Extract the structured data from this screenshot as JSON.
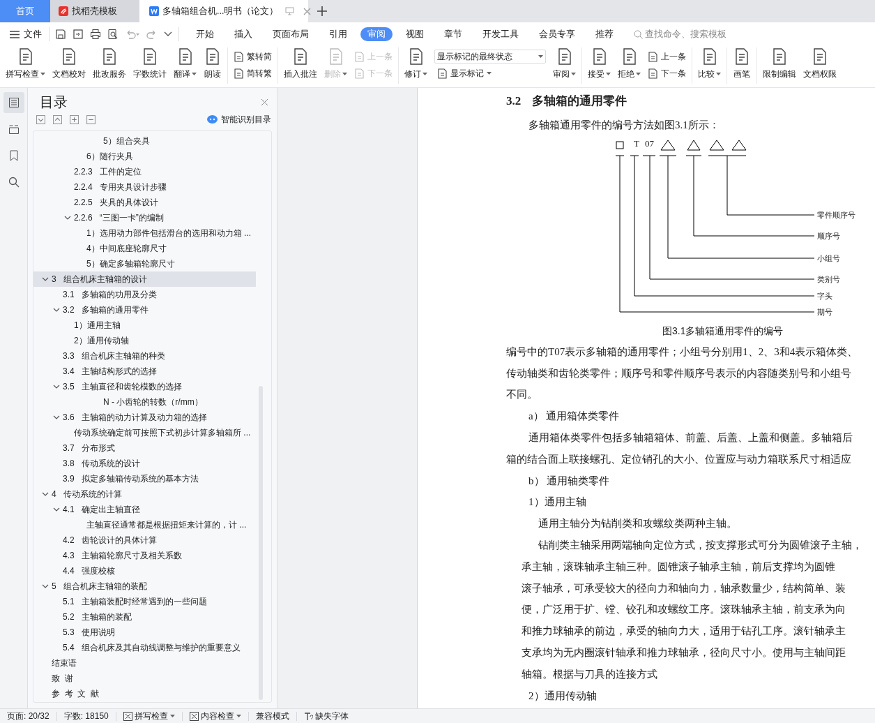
{
  "tabs": [
    {
      "kind": "home",
      "label": "首页",
      "selected": false
    },
    {
      "kind": "web",
      "label": "找稻壳模板",
      "selected": false
    },
    {
      "kind": "doc",
      "label": "多轴箱组合机...明书（论文）",
      "selected": true
    }
  ],
  "menu": {
    "file": "文件",
    "tabs": [
      {
        "label": "开始",
        "selected": false
      },
      {
        "label": "插入",
        "selected": false
      },
      {
        "label": "页面布局",
        "selected": false
      },
      {
        "label": "引用",
        "selected": false
      },
      {
        "label": "审阅",
        "selected": true
      },
      {
        "label": "视图",
        "selected": false
      },
      {
        "label": "章节",
        "selected": false
      },
      {
        "label": "开发工具",
        "selected": false
      },
      {
        "label": "会员专享",
        "selected": false
      },
      {
        "label": "推荐",
        "selected": false
      }
    ],
    "search": {
      "placeholder": "查找命令、搜索模板"
    }
  },
  "ribbon": {
    "groups": [
      [
        {
          "kind": "large",
          "label": "拼写检查",
          "dropdown": true,
          "disabled": false
        },
        {
          "kind": "large",
          "label": "文档校对",
          "dropdown": false,
          "disabled": false
        },
        {
          "kind": "large",
          "label": "批改服务",
          "dropdown": false,
          "disabled": false
        },
        {
          "kind": "large",
          "label": "字数统计",
          "dropdown": false,
          "disabled": false
        },
        {
          "kind": "large",
          "label": "翻译",
          "dropdown": true,
          "disabled": false
        },
        {
          "kind": "large",
          "label": "朗读",
          "dropdown": false,
          "disabled": false
        }
      ],
      [
        {
          "kind": "stack",
          "items": [
            {
              "label": "繁转简",
              "disabled": false
            },
            {
              "label": "简转繁",
              "disabled": false
            }
          ]
        }
      ],
      [
        {
          "kind": "large",
          "label": "插入批注",
          "dropdown": false,
          "disabled": false
        },
        {
          "kind": "large",
          "label": "删除",
          "dropdown": true,
          "disabled": true
        },
        {
          "kind": "stack",
          "items": [
            {
              "label": "上一条",
              "disabled": true
            },
            {
              "label": "下一条",
              "disabled": true
            }
          ]
        }
      ],
      [
        {
          "kind": "large",
          "label": "修订",
          "dropdown": true,
          "disabled": false
        },
        {
          "kind": "display",
          "select": "显示标记的最终状态",
          "button": "显示标记"
        },
        {
          "kind": "large",
          "label": "审阅",
          "dropdown": true,
          "disabled": false
        }
      ],
      [
        {
          "kind": "large",
          "label": "接受",
          "dropdown": true,
          "disabled": false
        },
        {
          "kind": "large",
          "label": "拒绝",
          "dropdown": true,
          "disabled": false
        },
        {
          "kind": "stack",
          "items": [
            {
              "label": "上一条",
              "disabled": false
            },
            {
              "label": "下一条",
              "disabled": false
            }
          ]
        }
      ],
      [
        {
          "kind": "large",
          "label": "比较",
          "dropdown": true,
          "disabled": false
        }
      ],
      [
        {
          "kind": "large",
          "label": "画笔",
          "dropdown": false,
          "disabled": false
        }
      ],
      [
        {
          "kind": "large",
          "label": "限制编辑",
          "dropdown": false,
          "disabled": false
        },
        {
          "kind": "large",
          "label": "文档权限",
          "dropdown": false,
          "disabled": false
        }
      ]
    ]
  },
  "rail": [
    {
      "selected": true
    },
    {
      "selected": false
    },
    {
      "selected": false
    },
    {
      "selected": false
    }
  ],
  "toc": {
    "title": "目录",
    "smart_button": "智能识别目录",
    "items": [
      {
        "kind": "deep",
        "label": "5）组合夹具",
        "expanded": false,
        "selected": false
      },
      {
        "kind": "item",
        "label": "6）随行夹具",
        "expanded": false,
        "selected": false
      },
      {
        "kind": "subsection",
        "label": "2.2.3   工件的定位",
        "expanded": false,
        "selected": false
      },
      {
        "kind": "subsection",
        "label": "2.2.4   专用夹具设计步骤",
        "expanded": false,
        "selected": false
      },
      {
        "kind": "subsection",
        "label": "2.2.5   夹具的具体设计",
        "expanded": false,
        "selected": false
      },
      {
        "kind": "subsection",
        "label": "2.2.6   “三图一卡”的编制",
        "expanded": true,
        "selected": false,
        "children": [
          {
            "kind": "item",
            "label": "1）选用动力部件包括滑台的选用和动力箱 ...",
            "expanded": false,
            "selected": false
          },
          {
            "kind": "item",
            "label": "4）中间底座轮廓尺寸",
            "expanded": false,
            "selected": false
          },
          {
            "kind": "item",
            "label": "5）确定多轴箱轮廓尺寸",
            "expanded": false,
            "selected": false
          }
        ]
      },
      {
        "kind": "chapter",
        "label": "3   组合机床主轴箱的设计",
        "expanded": true,
        "selected": true,
        "children": [
          {
            "kind": "section",
            "label": "3.1   多轴箱的功用及分类",
            "expanded": false,
            "selected": false
          },
          {
            "kind": "section",
            "label": "3.2   多轴箱的通用零件",
            "expanded": true,
            "selected": false,
            "children": [
              {
                "kind": "subsection",
                "label": "1）通用主轴",
                "expanded": false,
                "selected": false
              },
              {
                "kind": "subsection",
                "label": "2）通用传动轴",
                "expanded": false,
                "selected": false
              }
            ]
          },
          {
            "kind": "section",
            "label": "3.3   组合机床主轴箱的种类",
            "expanded": false,
            "selected": false
          },
          {
            "kind": "section",
            "label": "3.4   主轴结构形式的选择",
            "expanded": false,
            "selected": false
          },
          {
            "kind": "section",
            "label": "3.5   主轴直径和齿轮模数的选择",
            "expanded": true,
            "selected": false,
            "children": [
              {
                "kind": "deep",
                "label": "N - 小齿轮的转数（r/mm）",
                "expanded": false,
                "selected": false
              }
            ]
          },
          {
            "kind": "section",
            "label": "3.6   主轴箱的动力计算及动力箱的选择",
            "expanded": true,
            "selected": false,
            "children": [
              {
                "kind": "subsection",
                "label": "传动系统确定前可按照下式初步计算多轴箱所 ...",
                "expanded": false,
                "selected": false
              }
            ]
          },
          {
            "kind": "section",
            "label": "3.7   分布形式",
            "expanded": false,
            "selected": false
          },
          {
            "kind": "section",
            "label": "3.8   传动系统的设计",
            "expanded": false,
            "selected": false
          },
          {
            "kind": "section",
            "label": "3.9   拟定多轴箱传动系统的基本方法",
            "expanded": false,
            "selected": false
          }
        ]
      },
      {
        "kind": "chapter",
        "label": "4   传动系统的计算",
        "expanded": true,
        "selected": false,
        "children": [
          {
            "kind": "section",
            "label": "4.1   确定出主轴直径",
            "expanded": true,
            "selected": false,
            "children": [
              {
                "kind": "item",
                "label": "主轴直径通常都是根据扭矩来计算的，计 ...",
                "expanded": false,
                "selected": false
              }
            ]
          },
          {
            "kind": "section",
            "label": "4.2   齿轮设计的具体计算",
            "expanded": false,
            "selected": false
          },
          {
            "kind": "section",
            "label": "4.3   主轴箱轮廓尺寸及相关系数",
            "expanded": false,
            "selected": false
          },
          {
            "kind": "section",
            "label": "4.4   强度校核",
            "expanded": false,
            "selected": false
          }
        ]
      },
      {
        "kind": "chapter",
        "label": "5   组合机床主轴箱的装配",
        "expanded": true,
        "selected": false,
        "children": [
          {
            "kind": "section",
            "label": "5.1   主轴箱装配时经常遇到的一些问题",
            "expanded": false,
            "selected": false
          },
          {
            "kind": "section",
            "label": "5.2   主轴箱的装配",
            "expanded": false,
            "selected": false
          },
          {
            "kind": "section",
            "label": "5.3   使用说明",
            "expanded": false,
            "selected": false
          },
          {
            "kind": "section",
            "label": "5.4   组合机床及其自动线调整与维护的重要意义",
            "expanded": false,
            "selected": false
          }
        ]
      },
      {
        "kind": "chapter",
        "label": "结束语",
        "expanded": false,
        "selected": false
      },
      {
        "kind": "chapter",
        "label": "致  谢",
        "expanded": false,
        "selected": false
      },
      {
        "kind": "chapter",
        "label": "参  考  文  献",
        "expanded": false,
        "selected": false
      }
    ]
  },
  "document": {
    "heading": {
      "number": "3.2",
      "title": "多轴箱的通用零件"
    },
    "blocks": [
      {
        "kind": "indent",
        "text": "多轴箱通用零件的编号方法如图3.1所示："
      },
      {
        "kind": "figure",
        "code": [
          "T",
          "07"
        ],
        "labels": [
          "零件顺序号",
          "顺序号",
          "小组号",
          "类别号",
          "字头",
          "期号"
        ],
        "caption": "图3.1多轴箱通用零件的编号"
      },
      {
        "kind": "body",
        "text": "编号中的T07表示多轴箱的通用零件；小组号分别用1、2、3和4表示箱体类、"
      },
      {
        "kind": "body",
        "text": "传动轴类和齿轮类零件；顺序号和零件顺序号表示的内容随类别号和小组号"
      },
      {
        "kind": "body",
        "text": "不同。"
      },
      {
        "kind": "indent",
        "text": "a）  通用箱体类零件"
      },
      {
        "kind": "indent",
        "text": "通用箱体类零件包括多轴箱箱体、前盖、后盖、上盖和侧盖。多轴箱后"
      },
      {
        "kind": "body",
        "text": "箱的结合面上联接螺孔、定位销孔的大小、位置应与动力箱联系尺寸相适应"
      },
      {
        "kind": "indent",
        "text": "b）  通用轴类零件"
      },
      {
        "kind": "indent",
        "text": "1）通用主轴"
      },
      {
        "kind": "sub",
        "text": "通用主轴分为钻削类和攻螺纹类两种主轴。"
      },
      {
        "kind": "sub",
        "text": "钻削类主轴采用两端轴向定位方式，按支撑形式可分为圆锥滚子主轴，"
      },
      {
        "kind": "shifted",
        "text": "承主轴，滚珠轴承主轴三种。圆锥滚子轴承主轴，前后支撑均为圆锥"
      },
      {
        "kind": "shifted",
        "text": "滚子轴承，可承受较大的径向力和轴向力，轴承数量少，结构简单、装"
      },
      {
        "kind": "shifted",
        "text": "便，广泛用于扩、镗、铰孔和攻螺纹工序。滚珠轴承主轴，前支承为向"
      },
      {
        "kind": "shifted",
        "text": "和推力球轴承的前边，承受的轴向力大，适用于钻孔工序。滚针轴承主"
      },
      {
        "kind": "shifted",
        "text": "支承均为无内圈滚针轴承和推力球轴承，径向尺寸小。使用与主轴间距"
      },
      {
        "kind": "shifted",
        "text": "轴箱。根据与刀具的连接方式"
      },
      {
        "kind": "indent",
        "text": "2）通用传动轴"
      }
    ]
  },
  "status_bar": [
    {
      "kind": "text",
      "label": "页面: 20/32"
    },
    {
      "kind": "text",
      "label": "字数: 18150"
    },
    {
      "kind": "menu",
      "label": "拼写检查"
    },
    {
      "kind": "menu",
      "label": "内容检查"
    },
    {
      "kind": "text",
      "label": "兼容模式"
    },
    {
      "kind": "font",
      "label": "缺失字体"
    }
  ]
}
